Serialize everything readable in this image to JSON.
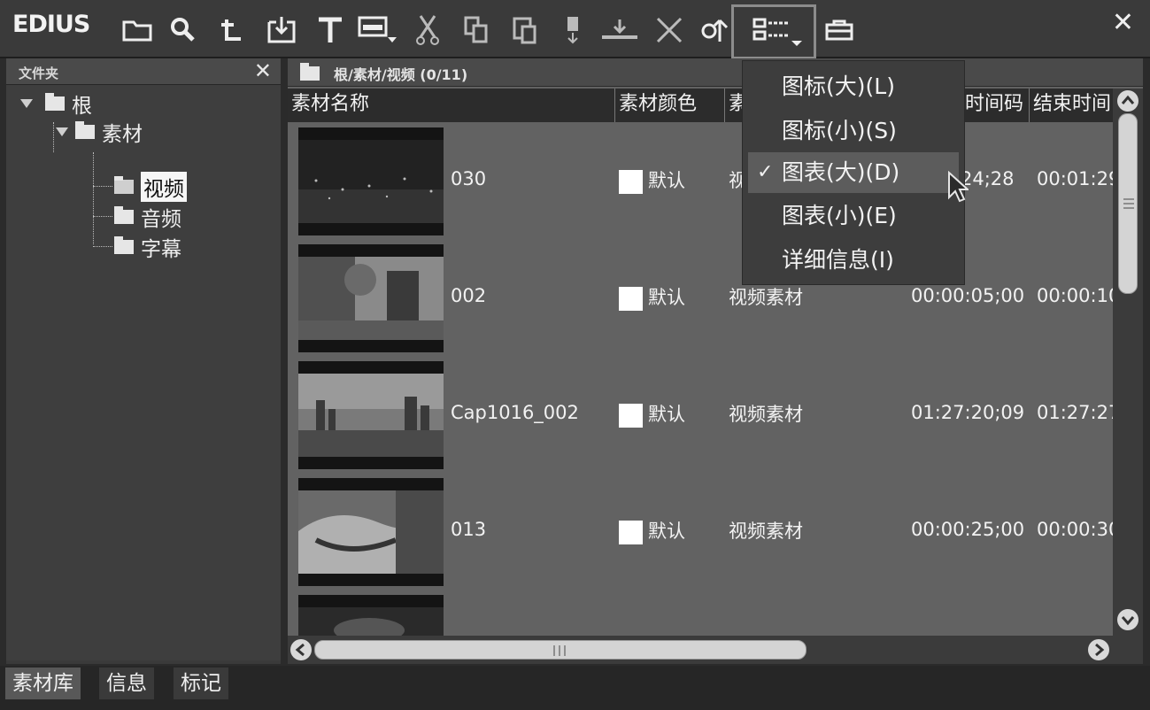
{
  "app": {
    "title": "EDIUS",
    "close_glyph": "✕"
  },
  "toolbar": {
    "icons": [
      "new-folder-icon",
      "search-icon",
      "up-level-icon",
      "import-icon",
      "title-icon",
      "add-to-timeline-icon",
      "cut-icon",
      "copy-icon",
      "paste-icon",
      "add-to-player-icon",
      "insert-icon",
      "delete-icon",
      "properties-icon",
      "view-mode-icon",
      "bin-icon"
    ]
  },
  "folder_panel": {
    "title": "文件夹",
    "close": "✕",
    "tree": [
      {
        "label": "根",
        "level": 0
      },
      {
        "label": "素材",
        "level": 1
      },
      {
        "label": "视频",
        "level": 2,
        "selected": true
      },
      {
        "label": "音频",
        "level": 2
      },
      {
        "label": "字幕",
        "level": 2
      }
    ]
  },
  "content": {
    "path": "根/素材/视频 (0/11)",
    "columns": [
      "素材名称",
      "素材颜色",
      "素",
      "时间码",
      "结束时间"
    ],
    "rows": [
      {
        "name": "030",
        "color": "默认",
        "type": "视",
        "timecode": "24;28",
        "end": "00:01:29"
      },
      {
        "name": "002",
        "color": "默认",
        "type": "视频素材",
        "timecode": "00:00:05;00",
        "end": "00:00:10"
      },
      {
        "name": "Cap1016_002",
        "color": "默认",
        "type": "视频素材",
        "timecode": "01:27:20;09",
        "end": "01:27:27"
      },
      {
        "name": "013",
        "color": "默认",
        "type": "视频素材",
        "timecode": "00:00:25;00",
        "end": "00:00:30"
      }
    ]
  },
  "view_menu": {
    "items": [
      {
        "label": "图标(大)(L)",
        "checked": false
      },
      {
        "label": "图标(小)(S)",
        "checked": false
      },
      {
        "label": "图表(大)(D)",
        "checked": true
      },
      {
        "label": "图表(小)(E)",
        "checked": false
      },
      {
        "label": "详细信息(I)",
        "checked": false
      }
    ],
    "check_glyph": "✓"
  },
  "bottom_tabs": [
    "素材库",
    "信息",
    "标记"
  ]
}
